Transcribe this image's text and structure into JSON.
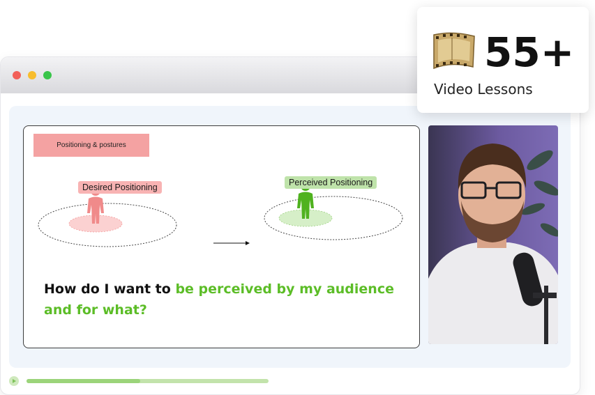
{
  "badge": {
    "count": "55+",
    "label": "Video Lessons",
    "icon": "film-reel-icon"
  },
  "slide": {
    "tag": "Positioning & postures",
    "desired_label": "Desired Positioning",
    "perceived_label": "Perceived Positioning",
    "question_part1": "How do I want to ",
    "question_highlight": "be perceived by my audience and for what?",
    "colors": {
      "desired": "#f08a8a",
      "perceived": "#5cbd27",
      "highlight": "#5cbd27"
    }
  },
  "player": {
    "progress": 0.47,
    "play_icon": "play-icon",
    "colors": {
      "track": "#c2e3ab"
    }
  }
}
